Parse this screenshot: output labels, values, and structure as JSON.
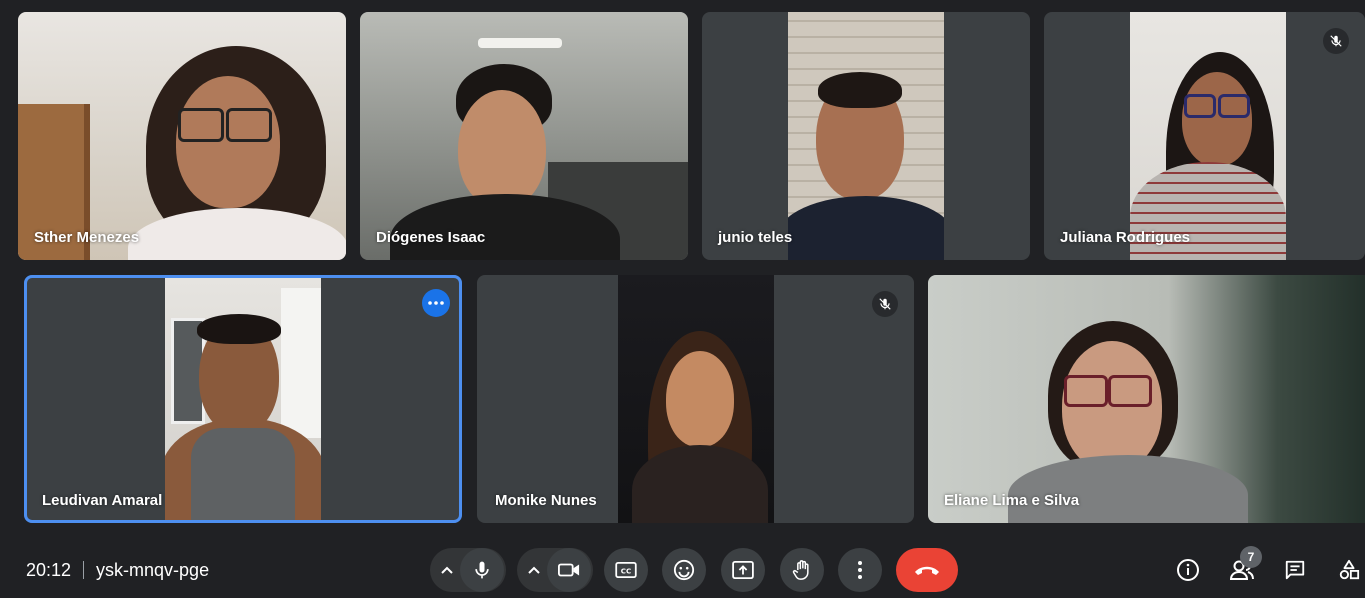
{
  "participants": [
    {
      "name": "Sther Menezes",
      "muted": false
    },
    {
      "name": "Diógenes Isaac",
      "muted": false
    },
    {
      "name": "junio teles",
      "muted": false
    },
    {
      "name": "Juliana Rodrigues",
      "muted": true
    },
    {
      "name": "Leudivan Amaral",
      "muted": false,
      "active": true
    },
    {
      "name": "Monike Nunes",
      "muted": true
    },
    {
      "name": "Eliane Lima e Silva",
      "muted": false
    }
  ],
  "meeting": {
    "time": "20:12",
    "code": "ysk-mnqv-pge"
  },
  "people_count": "7",
  "colors": {
    "accent": "#1a73e8",
    "end_call": "#ea4335",
    "tile": "#3c4043",
    "background": "#202124"
  },
  "icons": [
    "microphone-icon",
    "camera-icon",
    "captions-icon",
    "emoji-icon",
    "present-icon",
    "raise-hand-icon",
    "more-options-icon",
    "end-call-icon",
    "info-icon",
    "people-icon",
    "chat-icon",
    "activities-icon"
  ]
}
